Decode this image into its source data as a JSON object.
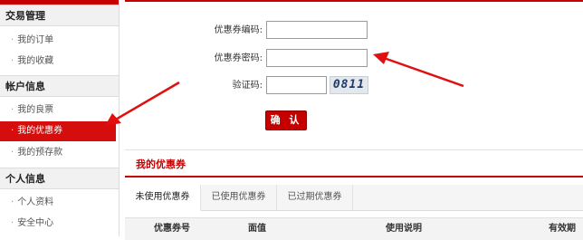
{
  "sidebar": {
    "sections": [
      {
        "title": "交易管理",
        "items": [
          "我的订单",
          "我的收藏"
        ]
      },
      {
        "title": "帐户信息",
        "items": [
          "我的良票",
          "我的优惠券",
          "我的预存款"
        ]
      },
      {
        "title": "个人信息",
        "items": [
          "个人资料",
          "安全中心"
        ]
      }
    ],
    "active_item": "我的优惠券",
    "bullet": "·"
  },
  "form": {
    "code_label": "优惠券编码:",
    "code_value": "",
    "password_label": "优惠券密码:",
    "password_value": "",
    "captcha_label": "验证码:",
    "captcha_value": "",
    "captcha_image_text": "0811",
    "confirm_label": "确 认"
  },
  "coupons": {
    "title": "我的优惠券",
    "tabs": [
      "未使用优惠券",
      "已使用优惠券",
      "已过期优惠券"
    ],
    "active_tab": "未使用优惠券",
    "columns": [
      "优惠券号",
      "面值",
      "使用说明",
      "有效期"
    ]
  },
  "colors": {
    "accent": "#c40000",
    "active_item_bg": "#d50d0d",
    "arrow": "#e01010"
  }
}
